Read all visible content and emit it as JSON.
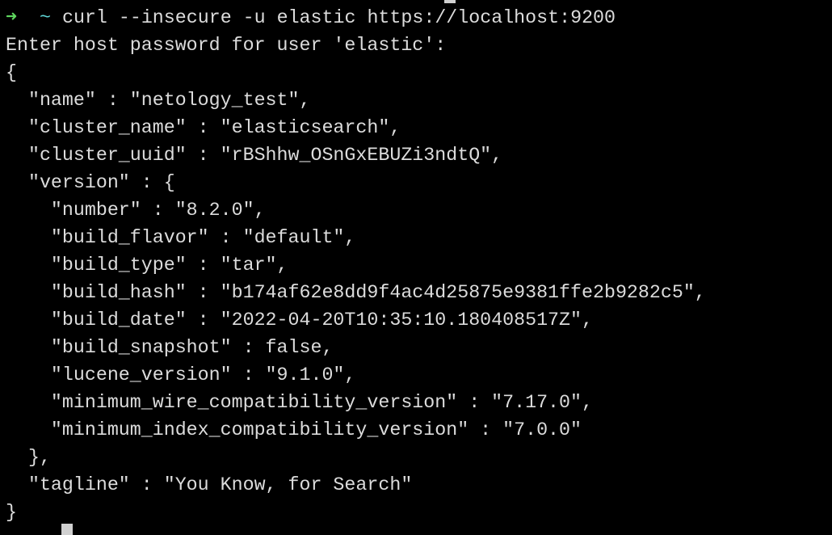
{
  "prompt": {
    "arrow": "➜",
    "dir": "~",
    "command": "curl --insecure -u elastic https://localhost:9200"
  },
  "output_lines": [
    "Enter host password for user 'elastic':",
    "{",
    "  \"name\" : \"netology_test\",",
    "  \"cluster_name\" : \"elasticsearch\",",
    "  \"cluster_uuid\" : \"rBShhw_OSnGxEBUZi3ndtQ\",",
    "  \"version\" : {",
    "    \"number\" : \"8.2.0\",",
    "    \"build_flavor\" : \"default\",",
    "    \"build_type\" : \"tar\",",
    "    \"build_hash\" : \"b174af62e8dd9f4ac4d25875e9381ffe2b9282c5\",",
    "    \"build_date\" : \"2022-04-20T10:35:10.180408517Z\",",
    "    \"build_snapshot\" : false,",
    "    \"lucene_version\" : \"9.1.0\",",
    "    \"minimum_wire_compatibility_version\" : \"7.17.0\",",
    "    \"minimum_index_compatibility_version\" : \"7.0.0\"",
    "  },",
    "  \"tagline\" : \"You Know, for Search\"",
    "}"
  ]
}
